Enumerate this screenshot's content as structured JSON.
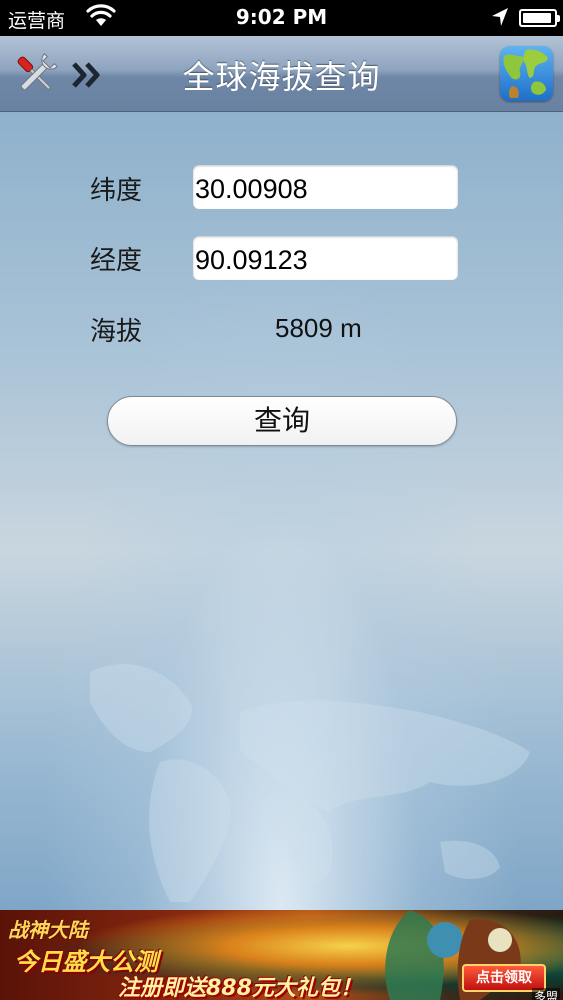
{
  "status_bar": {
    "carrier": "运营商",
    "time": "9:02 PM",
    "battery_level": 0.92
  },
  "nav": {
    "title": "全球海拔查询",
    "icons": {
      "settings": "tools-icon",
      "next": "double-chevron-right-icon",
      "globe": "globe-icon"
    }
  },
  "form": {
    "latitude_label": "纬度",
    "latitude_value": "30.00908",
    "longitude_label": "经度",
    "longitude_value": "90.09123",
    "altitude_label": "海拔",
    "altitude_value": "5809 m",
    "query_button": "查询"
  },
  "ad": {
    "line1": "战神大陆",
    "line2": "今日盛大公测",
    "line3": "注册即送888元大礼包！",
    "cta": "点击领取",
    "source": "多盟"
  },
  "colors": {
    "nav_bar": "#8ea4bf",
    "background": "#a9c3d7",
    "text": "#1a1a1a"
  }
}
